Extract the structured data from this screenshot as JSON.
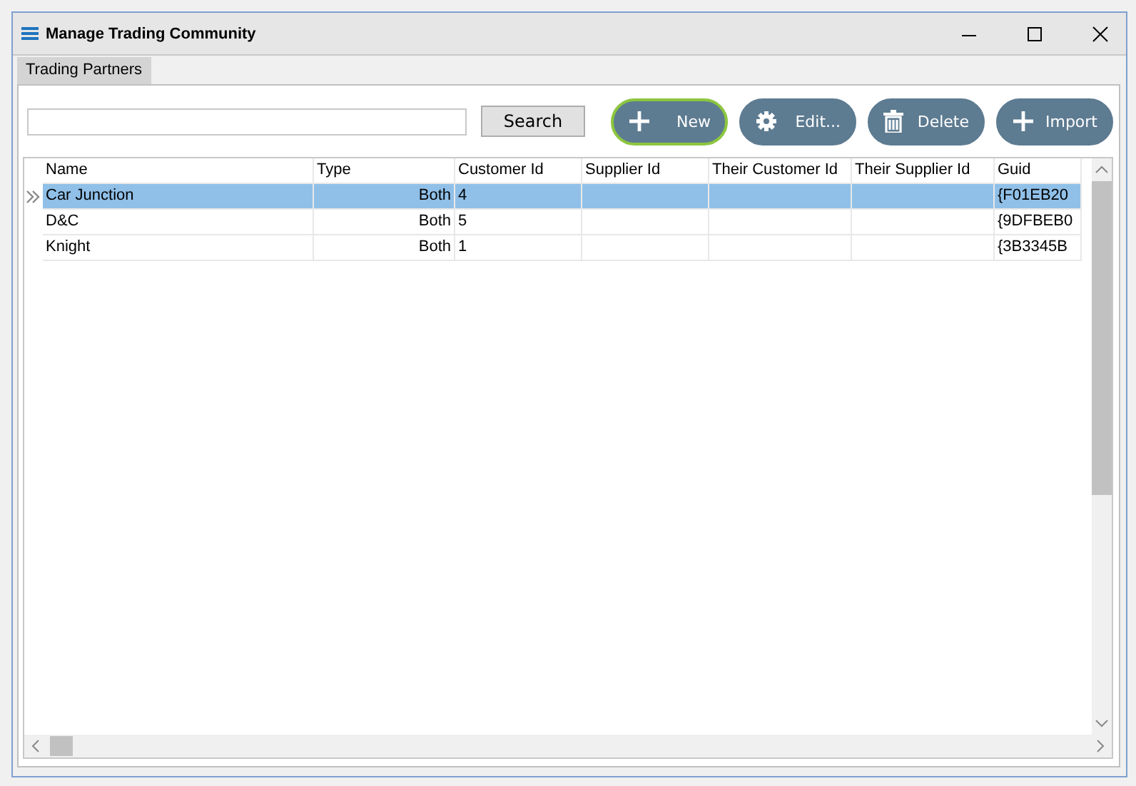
{
  "window": {
    "title": "Manage Trading Community"
  },
  "tabs": [
    {
      "label": "Trading Partners",
      "selected": true
    }
  ],
  "search_button": "Search",
  "buttons": [
    {
      "label": "New",
      "kind": "plus",
      "focused": true
    },
    {
      "label": "Edit...",
      "kind": "gear",
      "focused": false
    },
    {
      "label": "Delete",
      "kind": "trash",
      "focused": false
    },
    {
      "label": "Import",
      "kind": "plus",
      "focused": false
    }
  ],
  "table": {
    "columns": [
      "Name",
      "Type",
      "Customer Id",
      "Supplier Id",
      "Their Customer Id",
      "Their Supplier Id",
      "Guid"
    ],
    "rows": [
      {
        "cells": [
          "Car Junction",
          "Both",
          "4",
          "",
          "",
          "",
          "{F01EB20"
        ],
        "selected": true
      },
      {
        "cells": [
          "D&C",
          "Both",
          "5",
          "",
          "",
          "",
          "{9DFBEB0"
        ],
        "selected": false
      },
      {
        "cells": [
          "Knight",
          "Both",
          "1",
          "",
          "",
          "",
          "{3B3345B"
        ],
        "selected": false
      }
    ]
  }
}
